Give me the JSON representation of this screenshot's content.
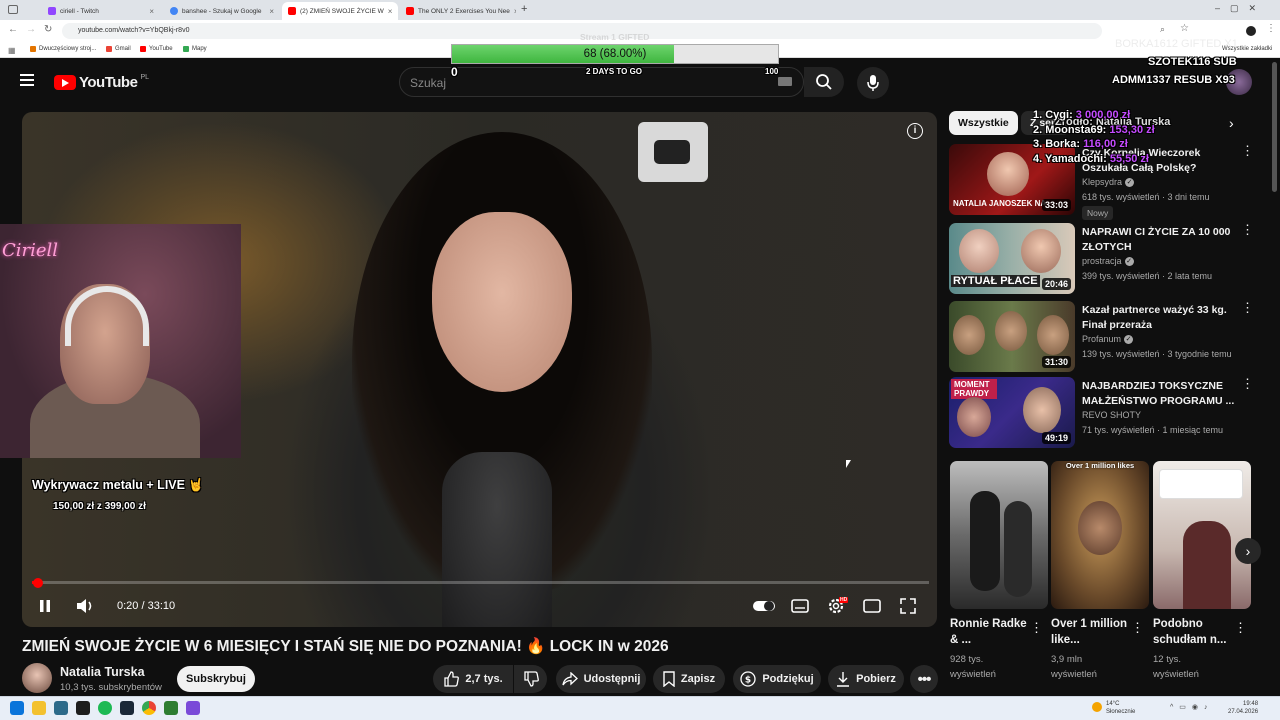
{
  "browser": {
    "tabs": [
      {
        "title": "ciriell - Twitch",
        "color": "#9146ff"
      },
      {
        "title": "banshee - Szukaj w Google",
        "color": "#4285f4"
      },
      {
        "title": "(2) ZMIEŃ SWOJE ŻYCIE W",
        "color": "#ff0000"
      },
      {
        "title": "The ONLY 2 Exercises You Nee",
        "color": "#ff0000"
      }
    ],
    "url": "youtube.com/watch?v=YbQBkj-r8v0",
    "bookmarks": [
      "Dwuczęściowy stroj...",
      "Gmail",
      "YouTube",
      "Mapy"
    ],
    "bookmarks_right": "Wszystkie zakładki"
  },
  "youtube": {
    "logo_text": "YouTube",
    "region": "PL",
    "search_placeholder": "Szukaj"
  },
  "goal": {
    "label": "Stream 1 GIFTED",
    "text": "68 (68.00%)",
    "progress_percent": 68,
    "min": "0",
    "max": "100",
    "days": "2 DAYS TO GO"
  },
  "overlays": {
    "top_right_1": "BORKA1612  GIFTED X1",
    "top_right_2": "SZOTEK116  SUB",
    "top_right_3": "ADMM1337  RESUB X93",
    "leaderboard": [
      {
        "name": "1. Cygi:",
        "amount": "3 000,00 zł"
      },
      {
        "name": "2. Moonsta69:",
        "amount": "153,30 zł"
      },
      {
        "name": "3. Borka:",
        "amount": "116,00 zł"
      },
      {
        "name": "4. Yamadochi:",
        "amount": "55,50 zł"
      }
    ],
    "source": "Źródło: Natalia Turska",
    "cam_name": "Ciriell",
    "wykrywacz_title": "Wykrywacz metalu + LIVE 🤘",
    "wykrywacz_amount": "150,00 zł z 399,00 zł"
  },
  "player": {
    "time": "0:20 / 33:10",
    "progress_fraction": 0.01,
    "hd_badge": "HD"
  },
  "video": {
    "title": "ZMIEŃ SWOJE ŻYCIE W 6 MIESIĘCY I STAŃ SIĘ NIE DO POZNANIA! 🔥 LOCK IN w 2026",
    "channel": "Natalia Turska",
    "subscribers": "10,3 tys. subskrybentów",
    "subscribe_label": "Subskrybuj",
    "likes": "2,7 tys.",
    "share_label": "Udostępnij",
    "save_label": "Zapisz",
    "thanks_label": "Podziękuj",
    "download_label": "Pobierz"
  },
  "sidebar": {
    "chips": [
      "Wszystkie",
      "Z serii"
    ],
    "recommendations": [
      {
        "title": "Czy Kornelia Wieczorek Oszukała Całą Polskę?",
        "channel": "Klepsydra",
        "meta": "618 tys. wyświetleń · 3 dni temu",
        "duration": "33:03",
        "thumb_text": "NATALIA JANOSZEK NA",
        "badge": "Nowy"
      },
      {
        "title": "NAPRAWI CI ŻYCIE ZA 10 000 ZŁOTYCH",
        "channel": "prostracja",
        "meta": "399 tys. wyświetleń · 2 lata temu",
        "duration": "20:46",
        "thumb_text": "RYTUAŁ PŁACE"
      },
      {
        "title": "Kazał partnerce ważyć 33 kg. Finał przeraża",
        "channel": "Profanum",
        "meta": "139 tys. wyświetleń · 3 tygodnie temu",
        "duration": "31:30",
        "thumb_text": ""
      },
      {
        "title": "NAJBARDZIEJ TOKSYCZNE MAŁŻEŃSTWO PROGRAMU ...",
        "channel": "REVO SHOTY",
        "meta": "71 tys. wyświetleń · 1 miesiąc temu",
        "duration": "49:19",
        "thumb_text": "MOMENT PRAWDY"
      }
    ],
    "shorts": [
      {
        "title": "Ronnie Radke & ...",
        "meta1": "928 tys.",
        "meta2": "wyświetleń"
      },
      {
        "title": "Over 1 million like...",
        "meta1": "3,9 mln",
        "meta2": "wyświetleń",
        "overlay": "Over 1 million likes"
      },
      {
        "title": "Podobno schudłam n...",
        "meta1": "12 tys.",
        "meta2": "wyświetleń"
      }
    ]
  },
  "taskbar": {
    "weather_temp": "14°C",
    "weather_desc": "Słonecznie",
    "clock_time": "19:48",
    "clock_date": "27.04.2026"
  },
  "colors": {
    "yt_red": "#ff0000",
    "bg": "#0f0f0f",
    "goal_green": "#4cc34c",
    "leader_amount": "#c44bff"
  }
}
